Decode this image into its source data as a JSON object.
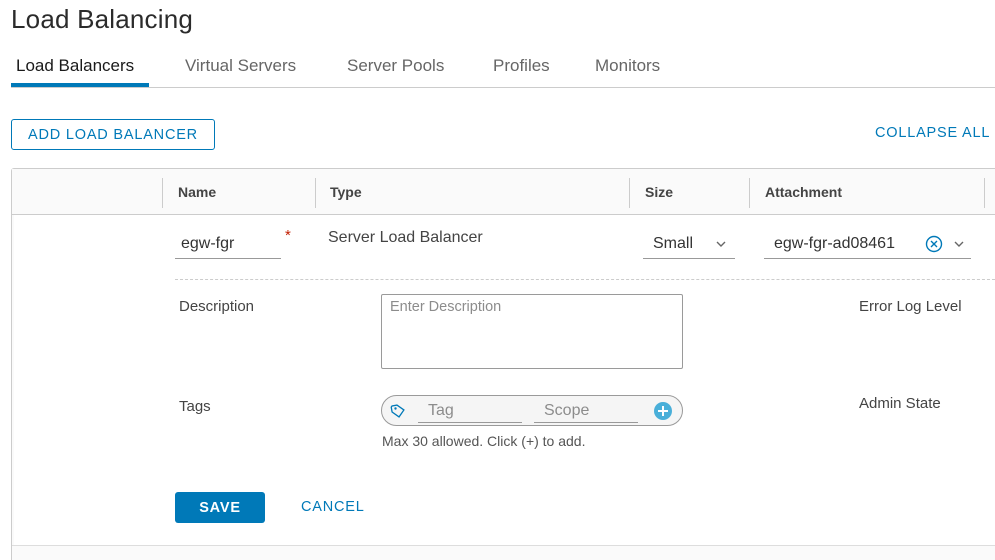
{
  "page": {
    "title": "Load Balancing"
  },
  "tabs": [
    {
      "label": "Load Balancers",
      "active": true
    },
    {
      "label": "Virtual Servers",
      "active": false
    },
    {
      "label": "Server Pools",
      "active": false
    },
    {
      "label": "Profiles",
      "active": false
    },
    {
      "label": "Monitors",
      "active": false
    }
  ],
  "toolbar": {
    "add_label": "ADD LOAD BALANCER",
    "collapse_label": "COLLAPSE ALL"
  },
  "grid": {
    "columns": [
      "Name",
      "Type",
      "Size",
      "Attachment"
    ]
  },
  "row": {
    "name": "egw-fgr",
    "required_mark": "*",
    "type": "Server Load Balancer",
    "size": "Small",
    "attachment": "egw-fgr-ad08461"
  },
  "details": {
    "description_label": "Description",
    "description_placeholder": "Enter Description",
    "tags_label": "Tags",
    "tag_placeholder": "Tag",
    "scope_placeholder": "Scope",
    "tags_hint": "Max 30 allowed. Click (+) to add.",
    "error_log_label": "Error Log Level",
    "admin_state_label": "Admin State"
  },
  "actions": {
    "save_label": "SAVE",
    "cancel_label": "CANCEL"
  },
  "colors": {
    "accent": "#0079b8",
    "required": "#c21d00",
    "border": "#cccccc"
  },
  "icons": {
    "clear": "clear-circle-icon",
    "chevron": "chevron-down-icon",
    "tag": "tag-icon",
    "add": "plus-circle-icon"
  }
}
